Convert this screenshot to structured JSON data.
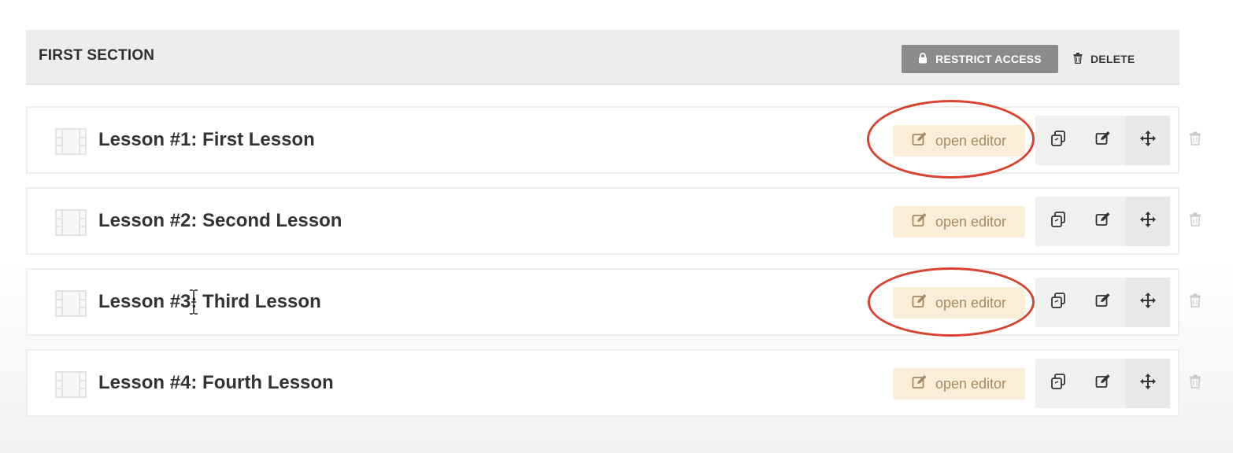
{
  "section": {
    "title": "FIRST SECTION",
    "restrict_label": "RESTRICT ACCESS",
    "delete_label": "DELETE"
  },
  "lessons": [
    {
      "title": "Lesson #1: First Lesson",
      "editor_label": "open editor",
      "highlighted": true
    },
    {
      "title": "Lesson #2: Second Lesson",
      "editor_label": "open editor",
      "highlighted": false
    },
    {
      "title": "Lesson #3: Third Lesson",
      "editor_label": "open editor",
      "highlighted": true
    },
    {
      "title": "Lesson #4: Fourth Lesson",
      "editor_label": "open editor",
      "highlighted": false
    }
  ],
  "icons": {
    "restrict": "lock-icon",
    "delete": "trash-icon",
    "lesson": "film-icon",
    "editor": "edit-icon",
    "duplicate": "duplicate-icon",
    "edit": "edit-icon",
    "move": "move-icon",
    "row_delete": "trash-icon"
  },
  "colors": {
    "header_bg": "#ededed",
    "restrict_bg": "#8b8b8b",
    "editor_bg": "#fbeed8",
    "editor_text": "#a58a64",
    "highlight": "#d9422f"
  }
}
